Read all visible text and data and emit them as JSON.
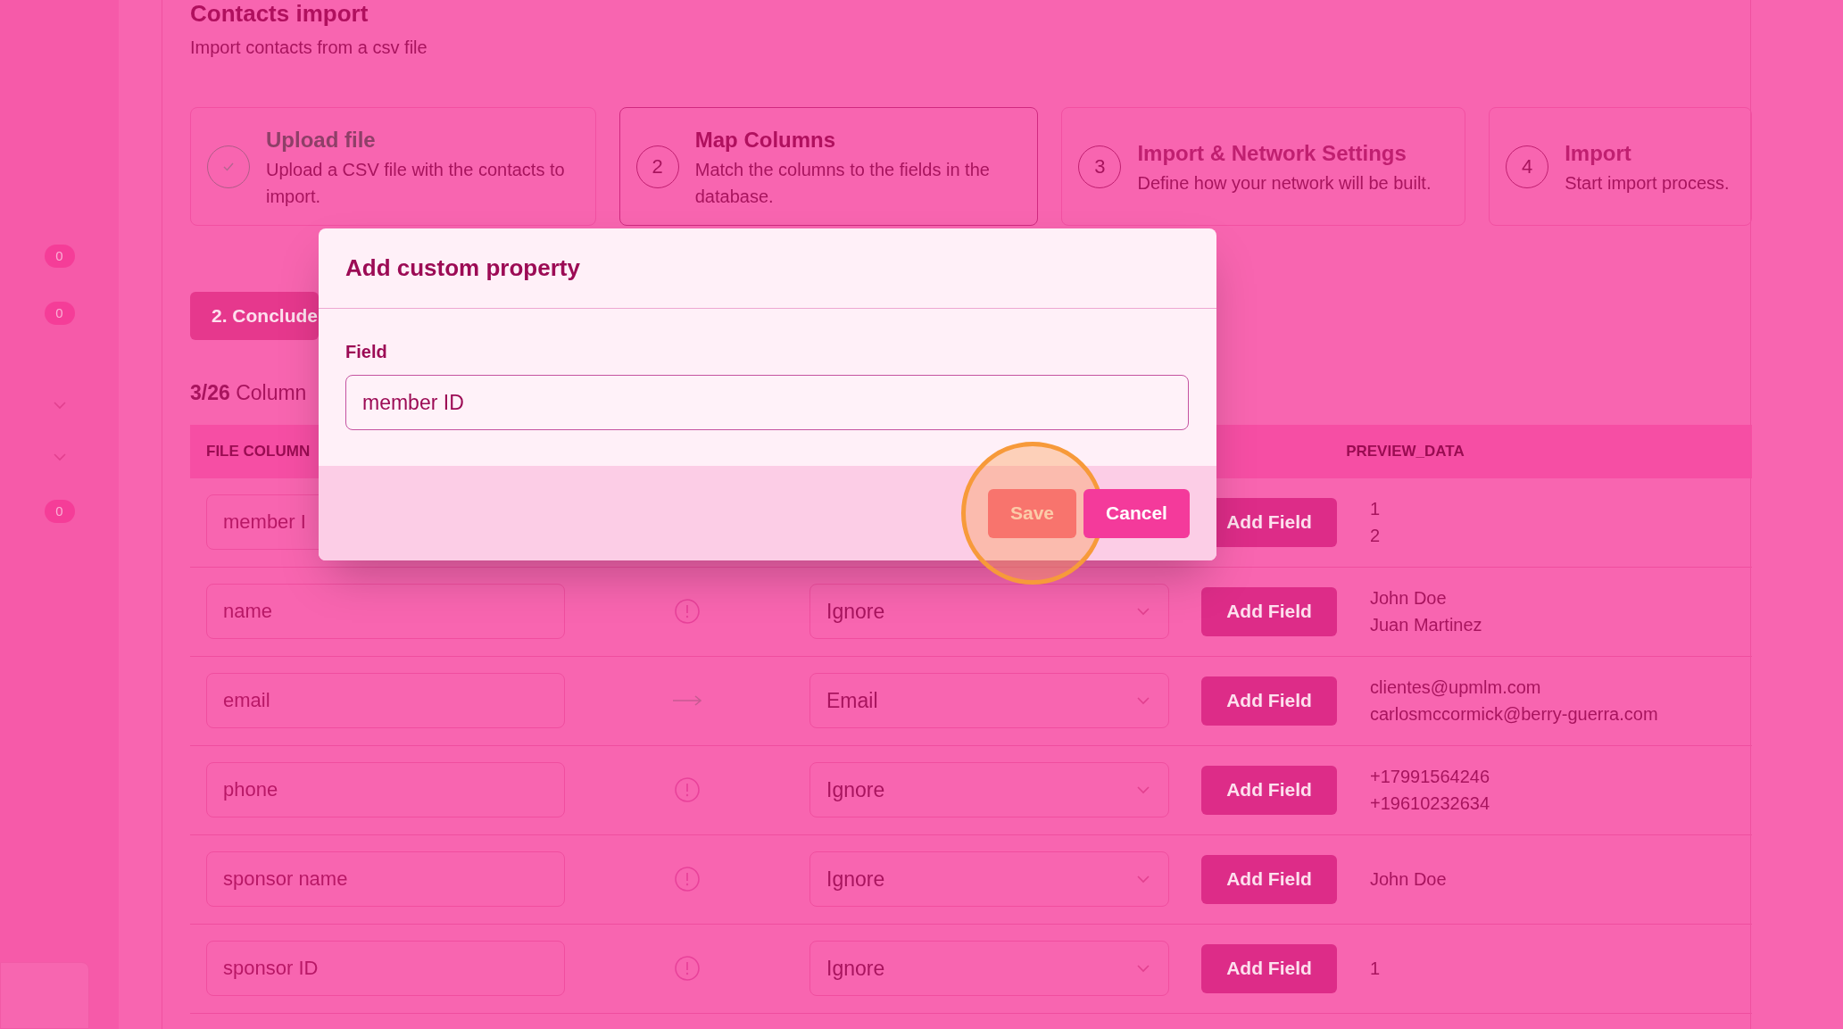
{
  "sidebar": {
    "items": [
      {
        "kind": "badge",
        "text": "0"
      },
      {
        "kind": "badge",
        "text": "0"
      },
      {
        "kind": "chevron"
      },
      {
        "kind": "chevron"
      },
      {
        "kind": "badge",
        "text": "0"
      }
    ]
  },
  "page": {
    "title": "Contacts import",
    "subtitle": "Import contacts from a csv file"
  },
  "steps": [
    {
      "kind": "done",
      "title": "Upload file",
      "description": "Upload a CSV file with the contacts to import."
    },
    {
      "kind": "active",
      "number": "2",
      "title": "Map Columns",
      "description": "Match the columns to the fields in the database."
    },
    {
      "kind": "pending",
      "number": "3",
      "title": "Import & Network Settings",
      "description": "Define how your network will be built."
    },
    {
      "kind": "pending",
      "number": "4",
      "title": "Import",
      "description": "Start import process."
    }
  ],
  "conclude_button": "2. Conclude",
  "columns_summary": "**3/26** Column",
  "table": {
    "headers": [
      "FILE COLUMN",
      "PREVIEW_DATA"
    ],
    "rows": [
      {
        "placeholder": "member I",
        "add_button": "Add Field",
        "preview": [
          "1",
          "2"
        ]
      },
      {
        "placeholder": "name",
        "kind": "unmapped",
        "field": "Ignore",
        "add_button": "Add Field",
        "preview": [
          "John Doe",
          "Juan Martinez"
        ]
      },
      {
        "placeholder": "email",
        "kind": "mapped",
        "field": "Email",
        "add_button": "Add Field",
        "preview": [
          "clientes@upmlm.com",
          "carlosmccormick@berry-guerra.com"
        ]
      },
      {
        "placeholder": "phone",
        "kind": "unmapped",
        "field": "Ignore",
        "add_button": "Add Field",
        "preview": [
          "+17991564246",
          "+19610232634"
        ]
      },
      {
        "placeholder": "sponsor name",
        "kind": "unmapped",
        "field": "Ignore",
        "add_button": "Add Field",
        "preview": [
          "John Doe"
        ]
      },
      {
        "placeholder": "sponsor ID",
        "kind": "unmapped",
        "field": "Ignore",
        "add_button": "Add Field",
        "preview": [
          "1"
        ]
      }
    ]
  },
  "modal": {
    "title": "Add custom property",
    "field_label": "Field",
    "value": "member ID",
    "buttons": [
      {
        "label": "Save",
        "kind": "primary",
        "highlighted": true
      },
      {
        "label": "Cancel",
        "kind": "secondary",
        "highlighted": false
      }
    ]
  }
}
